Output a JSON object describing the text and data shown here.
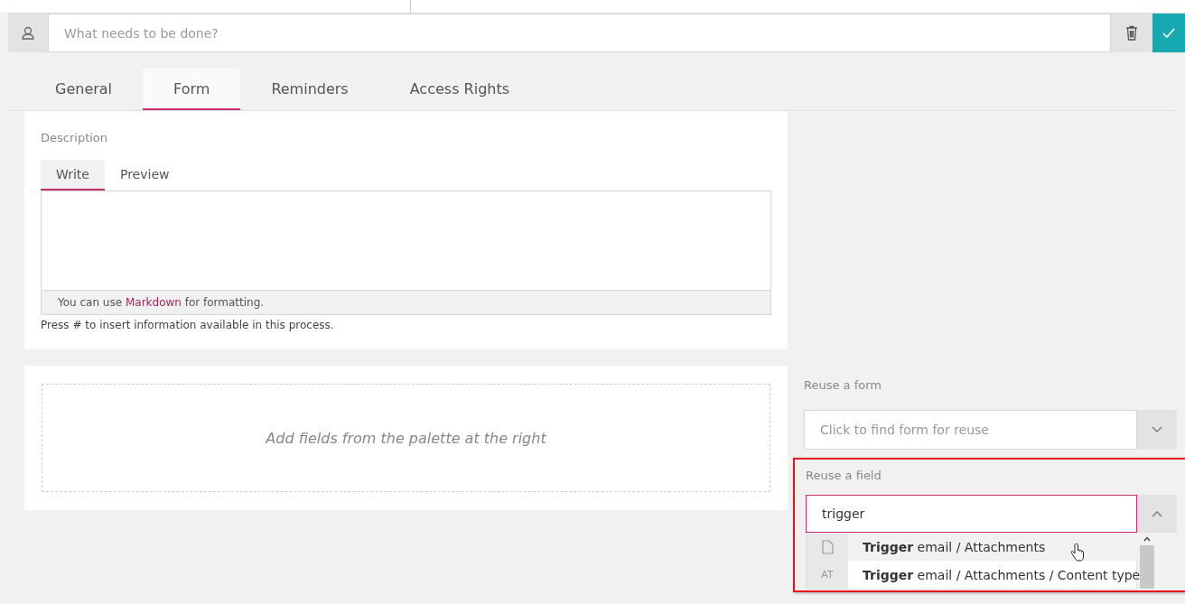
{
  "task_bar": {
    "placeholder": "What needs to be done?"
  },
  "tabs": [
    {
      "label": "General",
      "selected": false
    },
    {
      "label": "Form",
      "selected": true
    },
    {
      "label": "Reminders",
      "selected": false
    },
    {
      "label": "Access Rights",
      "selected": false
    }
  ],
  "description": {
    "label": "Description",
    "editor_tabs": [
      {
        "label": "Write",
        "selected": true
      },
      {
        "label": "Preview",
        "selected": false
      }
    ],
    "hint_before": "You can use",
    "hint_link": "Markdown",
    "hint_after": "for formatting.",
    "note": "Press # to insert information available in this process."
  },
  "fields_area": {
    "placeholder": "Add fields from the palette at the right"
  },
  "reuse_form": {
    "label": "Reuse a form",
    "placeholder": "Click to find form for reuse",
    "expanded": false
  },
  "reuse_field": {
    "label": "Reuse a field",
    "value": "trigger",
    "expanded": true,
    "options": [
      {
        "kind": "file",
        "label": "**Trigger** email / Attachments",
        "selected": true
      },
      {
        "kind": "text",
        "glyph": "AT",
        "label": "**Trigger** email / Attachments / Content type",
        "selected": false
      }
    ]
  }
}
